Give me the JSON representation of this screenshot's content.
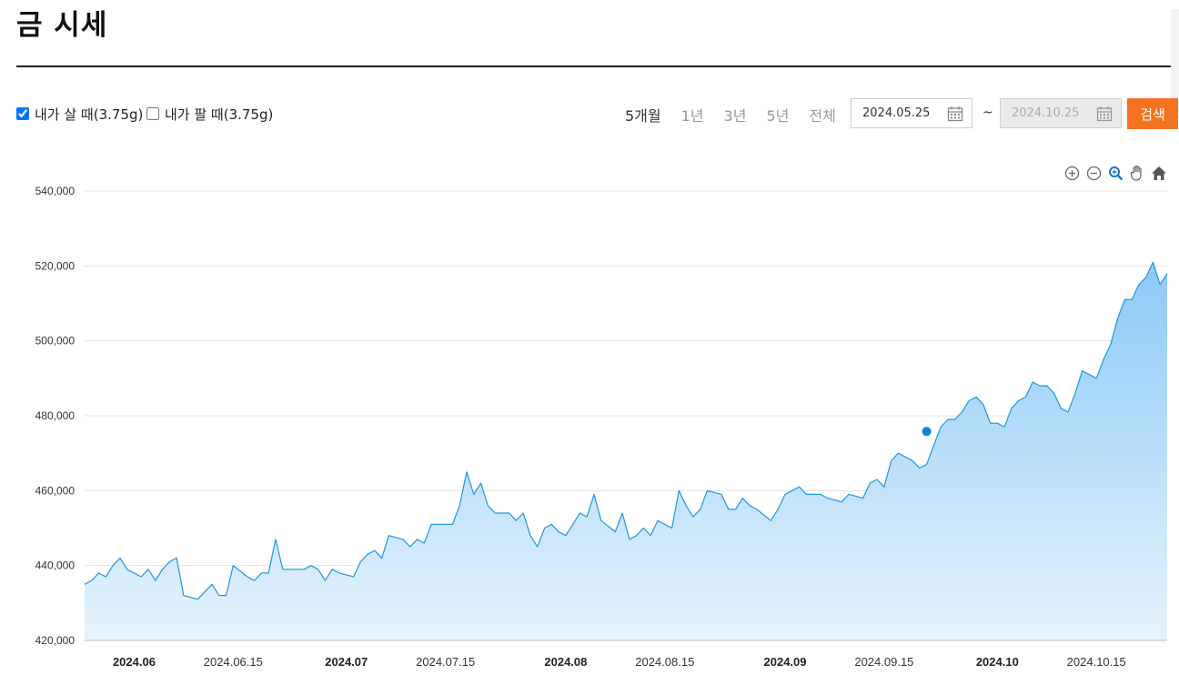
{
  "title": "금 시세",
  "options": {
    "buy": {
      "label": "내가 살 때(3.75g)",
      "checked": true
    },
    "sell": {
      "label": "내가 팔 때(3.75g)",
      "checked": false
    }
  },
  "periods": [
    {
      "label": "5개월",
      "active": true
    },
    {
      "label": "1년",
      "active": false
    },
    {
      "label": "3년",
      "active": false
    },
    {
      "label": "5년",
      "active": false
    },
    {
      "label": "전체",
      "active": false
    }
  ],
  "date_range": {
    "start": "2024.05.25",
    "separator": "~",
    "end": "2024.10.25"
  },
  "search_button": "검색",
  "zoom_tools": [
    "zoom-in-icon",
    "zoom-out-icon",
    "magnifier-icon",
    "pan-hand-icon",
    "home-icon"
  ],
  "colors": {
    "line": "#1e96e4",
    "fill_top": "#8ccaf7",
    "fill_bottom": "#e7f3fd",
    "accent": "#f47321",
    "marker": "#0a84e0"
  },
  "chart_data": {
    "type": "area",
    "ylim": [
      420000,
      540000
    ],
    "yticks": [
      420000,
      440000,
      460000,
      480000,
      500000,
      520000,
      540000
    ],
    "ytick_labels": [
      "420,000",
      "440,000",
      "460,000",
      "480,000",
      "500,000",
      "520,000",
      "540,000"
    ],
    "xlim": [
      "2024-05-25",
      "2024-10-25"
    ],
    "xticks": [
      {
        "date": "2024-06-01",
        "label": "2024.06",
        "major": true
      },
      {
        "date": "2024-06-15",
        "label": "2024.06.15",
        "major": false
      },
      {
        "date": "2024-07-01",
        "label": "2024.07",
        "major": true
      },
      {
        "date": "2024-07-15",
        "label": "2024.07.15",
        "major": false
      },
      {
        "date": "2024-08-01",
        "label": "2024.08",
        "major": true
      },
      {
        "date": "2024-08-15",
        "label": "2024.08.15",
        "major": false
      },
      {
        "date": "2024-09-01",
        "label": "2024.09",
        "major": true
      },
      {
        "date": "2024-09-15",
        "label": "2024.09.15",
        "major": false
      },
      {
        "date": "2024-10-01",
        "label": "2024.10",
        "major": true
      },
      {
        "date": "2024-10-15",
        "label": "2024.10.15",
        "major": false
      }
    ],
    "highlight": {
      "date": "2024-09-21",
      "value": 475800
    },
    "series": [
      {
        "points": [
          [
            "2024-05-25",
            435000
          ],
          [
            "2024-05-26",
            436000
          ],
          [
            "2024-05-27",
            438000
          ],
          [
            "2024-05-28",
            437000
          ],
          [
            "2024-05-29",
            440000
          ],
          [
            "2024-05-30",
            442000
          ],
          [
            "2024-05-31",
            439000
          ],
          [
            "2024-06-02",
            437000
          ],
          [
            "2024-06-03",
            439000
          ],
          [
            "2024-06-04",
            436000
          ],
          [
            "2024-06-05",
            439000
          ],
          [
            "2024-06-06",
            441000
          ],
          [
            "2024-06-07",
            442000
          ],
          [
            "2024-06-08",
            432000
          ],
          [
            "2024-06-10",
            431000
          ],
          [
            "2024-06-12",
            435000
          ],
          [
            "2024-06-13",
            432000
          ],
          [
            "2024-06-14",
            432000
          ],
          [
            "2024-06-15",
            440000
          ],
          [
            "2024-06-17",
            437000
          ],
          [
            "2024-06-18",
            436000
          ],
          [
            "2024-06-19",
            438000
          ],
          [
            "2024-06-20",
            438000
          ],
          [
            "2024-06-21",
            447000
          ],
          [
            "2024-06-22",
            439000
          ],
          [
            "2024-06-25",
            439000
          ],
          [
            "2024-06-26",
            440000
          ],
          [
            "2024-06-27",
            439000
          ],
          [
            "2024-06-28",
            436000
          ],
          [
            "2024-06-29",
            439000
          ],
          [
            "2024-06-30",
            438000
          ],
          [
            "2024-07-02",
            437000
          ],
          [
            "2024-07-03",
            441000
          ],
          [
            "2024-07-04",
            443000
          ],
          [
            "2024-07-05",
            444000
          ],
          [
            "2024-07-06",
            442000
          ],
          [
            "2024-07-07",
            448000
          ],
          [
            "2024-07-09",
            447000
          ],
          [
            "2024-07-10",
            445000
          ],
          [
            "2024-07-11",
            447000
          ],
          [
            "2024-07-12",
            446000
          ],
          [
            "2024-07-13",
            451000
          ],
          [
            "2024-07-16",
            451000
          ],
          [
            "2024-07-17",
            456000
          ],
          [
            "2024-07-18",
            465000
          ],
          [
            "2024-07-19",
            459000
          ],
          [
            "2024-07-20",
            462000
          ],
          [
            "2024-07-21",
            456000
          ],
          [
            "2024-07-22",
            454000
          ],
          [
            "2024-07-24",
            454000
          ],
          [
            "2024-07-25",
            452000
          ],
          [
            "2024-07-26",
            454000
          ],
          [
            "2024-07-27",
            448000
          ],
          [
            "2024-07-28",
            445000
          ],
          [
            "2024-07-29",
            450000
          ],
          [
            "2024-07-30",
            451000
          ],
          [
            "2024-07-31",
            449000
          ],
          [
            "2024-08-01",
            448000
          ],
          [
            "2024-08-02",
            451000
          ],
          [
            "2024-08-03",
            454000
          ],
          [
            "2024-08-04",
            453000
          ],
          [
            "2024-08-05",
            459000
          ],
          [
            "2024-08-06",
            452000
          ],
          [
            "2024-08-08",
            449000
          ],
          [
            "2024-08-09",
            454000
          ],
          [
            "2024-08-10",
            447000
          ],
          [
            "2024-08-11",
            448000
          ],
          [
            "2024-08-12",
            450000
          ],
          [
            "2024-08-13",
            448000
          ],
          [
            "2024-08-14",
            452000
          ],
          [
            "2024-08-16",
            450000
          ],
          [
            "2024-08-17",
            460000
          ],
          [
            "2024-08-18",
            456000
          ],
          [
            "2024-08-19",
            453000
          ],
          [
            "2024-08-20",
            455000
          ],
          [
            "2024-08-21",
            460000
          ],
          [
            "2024-08-23",
            459000
          ],
          [
            "2024-08-24",
            455000
          ],
          [
            "2024-08-25",
            455000
          ],
          [
            "2024-08-26",
            458000
          ],
          [
            "2024-08-27",
            456000
          ],
          [
            "2024-08-28",
            455000
          ],
          [
            "2024-08-30",
            452000
          ],
          [
            "2024-08-31",
            455000
          ],
          [
            "2024-09-01",
            459000
          ],
          [
            "2024-09-02",
            460000
          ],
          [
            "2024-09-03",
            461000
          ],
          [
            "2024-09-04",
            459000
          ],
          [
            "2024-09-06",
            459000
          ],
          [
            "2024-09-07",
            458000
          ],
          [
            "2024-09-09",
            457000
          ],
          [
            "2024-09-10",
            459000
          ],
          [
            "2024-09-12",
            458000
          ],
          [
            "2024-09-13",
            462000
          ],
          [
            "2024-09-14",
            463000
          ],
          [
            "2024-09-15",
            461000
          ],
          [
            "2024-09-16",
            468000
          ],
          [
            "2024-09-17",
            470000
          ],
          [
            "2024-09-18",
            469000
          ],
          [
            "2024-09-19",
            468000
          ],
          [
            "2024-09-20",
            466000
          ],
          [
            "2024-09-21",
            467000
          ],
          [
            "2024-09-22",
            472000
          ],
          [
            "2024-09-23",
            477000
          ],
          [
            "2024-09-24",
            479000
          ],
          [
            "2024-09-25",
            479000
          ],
          [
            "2024-09-26",
            481000
          ],
          [
            "2024-09-27",
            484000
          ],
          [
            "2024-09-28",
            485000
          ],
          [
            "2024-09-29",
            483000
          ],
          [
            "2024-09-30",
            478000
          ],
          [
            "2024-10-01",
            478000
          ],
          [
            "2024-10-02",
            477000
          ],
          [
            "2024-10-03",
            482000
          ],
          [
            "2024-10-04",
            484000
          ],
          [
            "2024-10-05",
            485000
          ],
          [
            "2024-10-06",
            489000
          ],
          [
            "2024-10-07",
            488000
          ],
          [
            "2024-10-08",
            488000
          ],
          [
            "2024-10-09",
            486000
          ],
          [
            "2024-10-10",
            482000
          ],
          [
            "2024-10-11",
            481000
          ],
          [
            "2024-10-12",
            486000
          ],
          [
            "2024-10-13",
            492000
          ],
          [
            "2024-10-14",
            491000
          ],
          [
            "2024-10-15",
            490000
          ],
          [
            "2024-10-16",
            495000
          ],
          [
            "2024-10-17",
            499000
          ],
          [
            "2024-10-18",
            506000
          ],
          [
            "2024-10-19",
            511000
          ],
          [
            "2024-10-20",
            511000
          ],
          [
            "2024-10-21",
            515000
          ],
          [
            "2024-10-22",
            517000
          ],
          [
            "2024-10-23",
            521000
          ],
          [
            "2024-10-24",
            515000
          ],
          [
            "2024-10-25",
            518000
          ]
        ]
      }
    ]
  }
}
